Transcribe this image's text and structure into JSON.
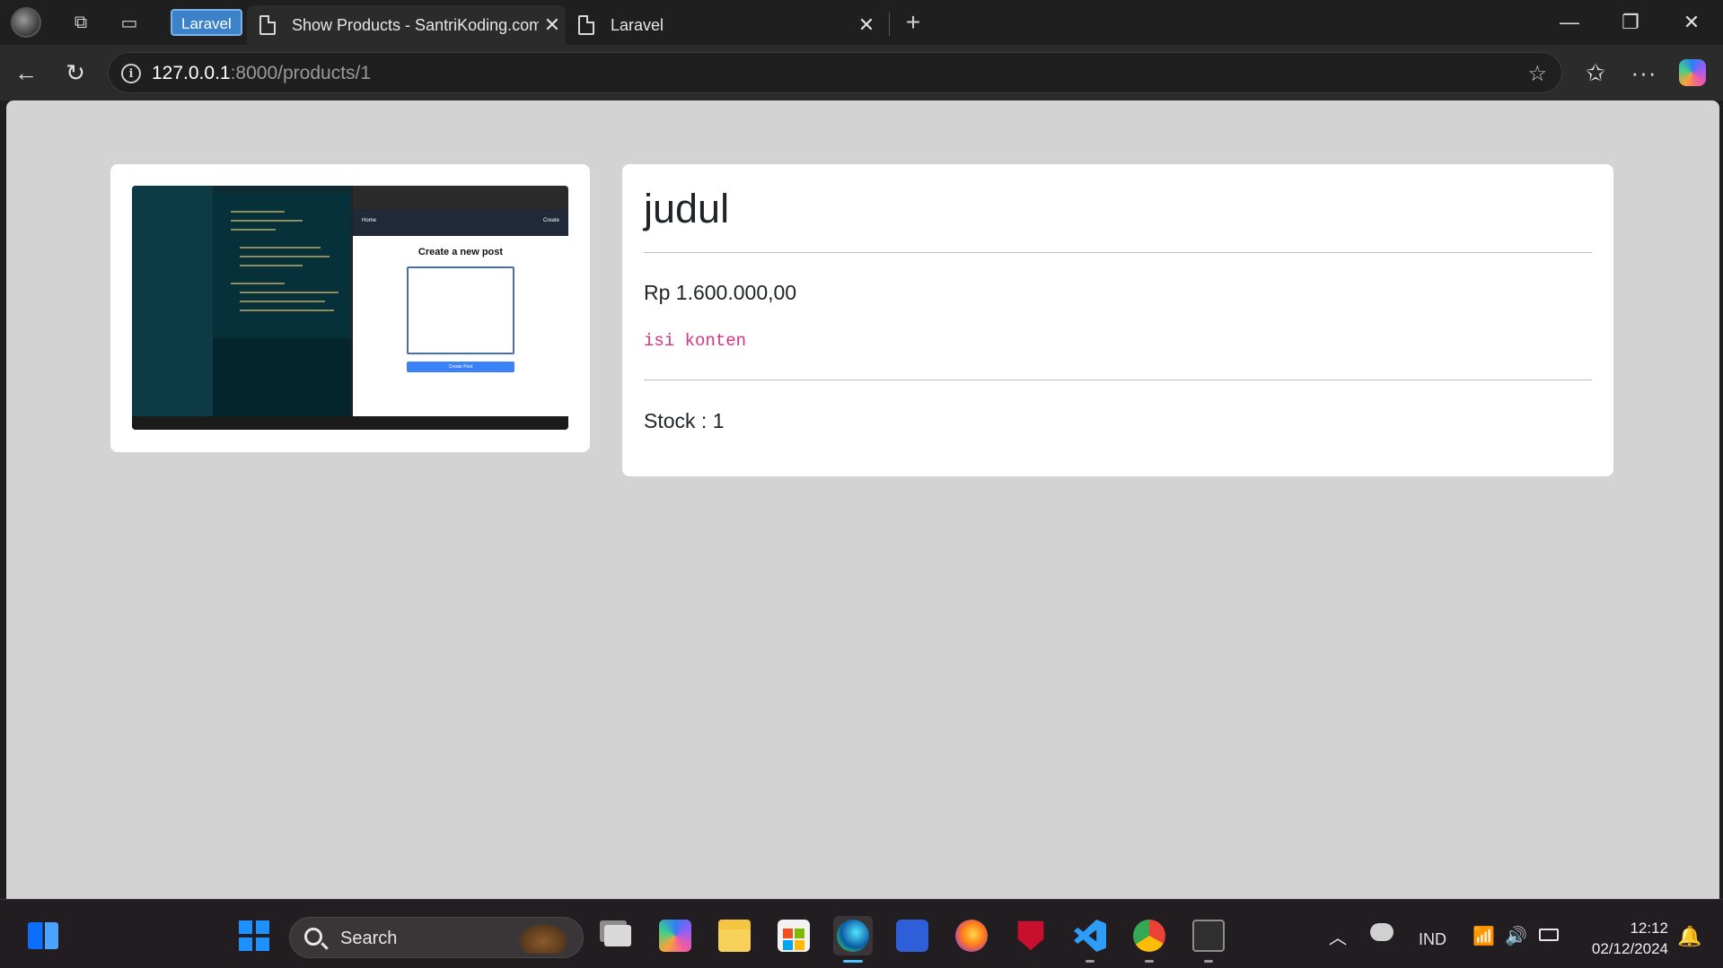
{
  "browser": {
    "tab_group_label": "Laravel",
    "tabs": [
      {
        "title": "Show Products - SantriKoding.com",
        "active": true
      },
      {
        "title": "Laravel",
        "active": false
      }
    ],
    "address": {
      "host": "127.0.0.1",
      "rest": ":8000/products/1"
    },
    "icons": {
      "back": "back-arrow-icon",
      "reload": "reload-icon",
      "info": "site-info-icon",
      "favorite": "star-icon",
      "favorites": "favorites-icon",
      "more": "more-icon",
      "copilot": "copilot-icon"
    }
  },
  "product": {
    "title": "judul",
    "price": "Rp 1.600.000,00",
    "content": "isi konten",
    "stock": "Stock : 1",
    "image": {
      "heading": "Create a new post",
      "nav_left": "Home",
      "nav_right": "Create",
      "button": "Create Post"
    }
  },
  "taskbar": {
    "search_label": "Search",
    "language": "IND",
    "time": "12:12",
    "date": "02/12/2024",
    "apps": [
      "widgets",
      "start",
      "task-view",
      "copilot",
      "file-explorer",
      "microsoft-store",
      "edge",
      "visual-studio",
      "firefox",
      "mcafee",
      "vscode",
      "chrome",
      "terminal"
    ]
  },
  "colors": {
    "page_background": "#d3d3d3",
    "card_background": "#ffffff",
    "content_pink": "#d63384",
    "tab_group_blue": "#3b82c8",
    "edge_running_indicator": "#4cc2ff"
  }
}
